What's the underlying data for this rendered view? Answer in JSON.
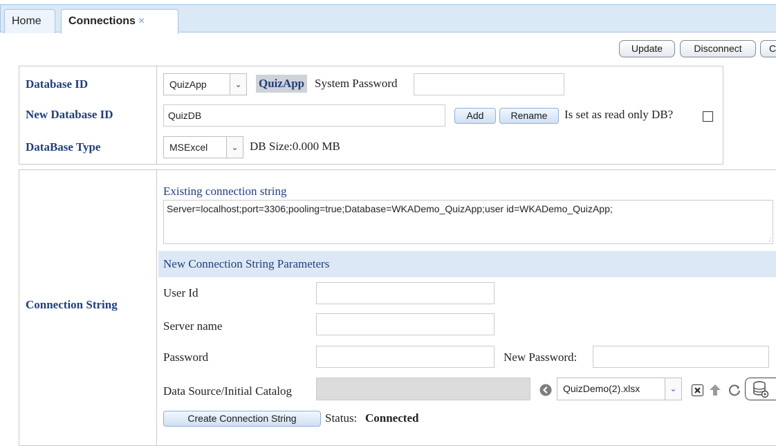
{
  "tabs": [
    {
      "label": "Home"
    },
    {
      "label": "Connections",
      "close": "×"
    }
  ],
  "toolbar": {
    "update_label": "Update",
    "disconnect_label": "Disconnect",
    "third_label": "C"
  },
  "database": {
    "id_label": "Database ID",
    "id_value": "QuizApp",
    "id_badge": "QuizApp",
    "system_password_label": "System Password",
    "system_password_value": "",
    "new_id_label": "New Database ID",
    "new_id_value": "QuizDB",
    "add_label": "Add",
    "rename_label": "Rename",
    "read_only_label": "Is set as read only DB?",
    "type_label": "DataBase Type",
    "type_value": "MSExcel",
    "size_label": "DB Size:0.000 MB"
  },
  "connection": {
    "section_label": "Connection String",
    "existing_label": "Existing connection string",
    "existing_value": "Server=localhost;port=3306;pooling=true;Database=WKADemo_QuizApp;user id=WKADemo_QuizApp;",
    "params_header": "New Connection String Parameters",
    "user_id_label": "User Id",
    "user_id_value": "",
    "server_name_label": "Server name",
    "server_name_value": "",
    "password_label": "Password",
    "password_value": "",
    "new_password_label": "New Password:",
    "new_password_value": "",
    "data_source_label": "Data Source/Initial Catalog",
    "data_source_value": "",
    "file_select_value": "QuizDemo(2).xlsx",
    "create_button_label": "Create Connection String",
    "status_label": "Status:",
    "status_value": "Connected"
  },
  "icons": {
    "back": "circle-left-arrow-icon",
    "clear": "clear-x-icon",
    "upload": "upload-icon",
    "refresh": "refresh-icon",
    "database": "database-settings-icon"
  }
}
